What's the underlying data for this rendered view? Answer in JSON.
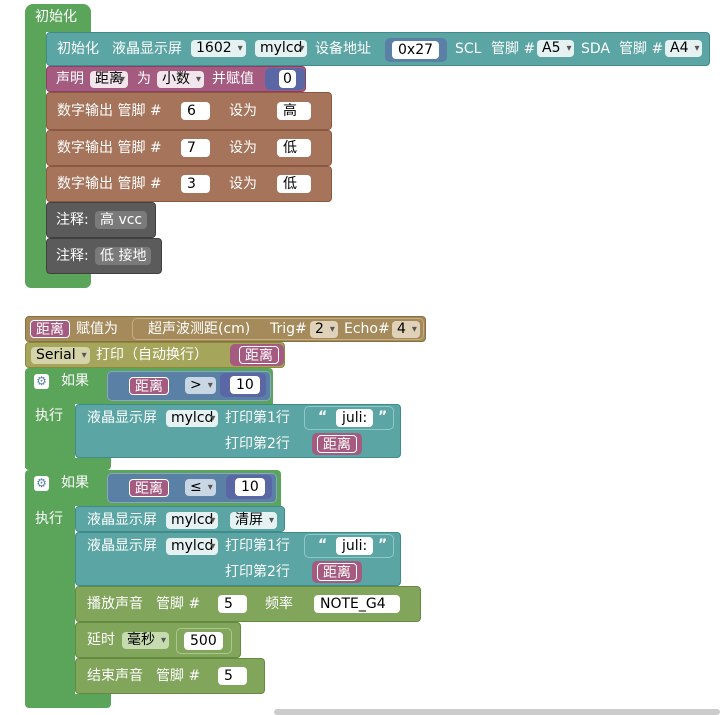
{
  "setup": {
    "hat": "初始化",
    "lcd_init": {
      "prefix": "初始化",
      "label": "液晶显示屏",
      "type": "1602",
      "name": "mylcd",
      "addr_label": "设备地址",
      "addr": "0x27",
      "scl": "SCL",
      "pin_label1": "管脚 #",
      "scl_pin": "A5",
      "sda": "SDA",
      "pin_label2": "管脚 #",
      "sda_pin": "A4"
    },
    "declare": {
      "label": "声明",
      "var": "距离",
      "as": "为",
      "type": "小数",
      "assign": "并赋值",
      "value": "0"
    },
    "digital": [
      {
        "label": "数字输出 管脚 #",
        "pin": "6",
        "set": "设为",
        "level": "高"
      },
      {
        "label": "数字输出 管脚 #",
        "pin": "7",
        "set": "设为",
        "level": "低"
      },
      {
        "label": "数字输出 管脚 #",
        "pin": "3",
        "set": "设为",
        "level": "低"
      }
    ],
    "comments": [
      {
        "label": "注释:",
        "text": "高 vcc"
      },
      {
        "label": "注释:",
        "text": "低 接地"
      }
    ]
  },
  "loop": {
    "assign": {
      "var": "距离",
      "label": "赋值为",
      "sensor": "超声波测距(cm)",
      "trig": "Trig#",
      "trig_pin": "2",
      "echo": "Echo#",
      "echo_pin": "4"
    },
    "serial": {
      "port": "Serial",
      "label": "打印（自动换行）",
      "var": "距离"
    },
    "if1": {
      "if_label": "如果",
      "var": "距离",
      "op": ">",
      "value": "10",
      "do_label": "执行",
      "lcd": {
        "label": "液晶显示屏",
        "name": "mylcd",
        "line1": "打印第1行",
        "text": "juli:",
        "line2": "打印第2行",
        "var": "距离"
      }
    },
    "if2": {
      "if_label": "如果",
      "var": "距离",
      "op": "≤",
      "value": "10",
      "do_label": "执行",
      "clear": {
        "label": "液晶显示屏",
        "name": "mylcd",
        "action": "清屏"
      },
      "lcd": {
        "label": "液晶显示屏",
        "name": "mylcd",
        "line1": "打印第1行",
        "text": "juli:",
        "line2": "打印第2行",
        "var": "距离"
      },
      "tone": {
        "label": "播放声音",
        "pin_label": "管脚 #",
        "pin": "5",
        "freq_label": "频率",
        "note": "NOTE_G4"
      },
      "delay": {
        "label": "延时",
        "unit": "毫秒",
        "value": "500"
      },
      "notone": {
        "label": "结束声音",
        "pin_label": "管脚 #",
        "pin": "5"
      }
    }
  },
  "colors": {
    "green": "#5ba55b",
    "teal": "#5ba5a5",
    "brown": "#a5745b",
    "purple": "#a55b80",
    "olive": "#a5a55b",
    "blue": "#5b80a5",
    "gray": "#5b5b5b"
  }
}
